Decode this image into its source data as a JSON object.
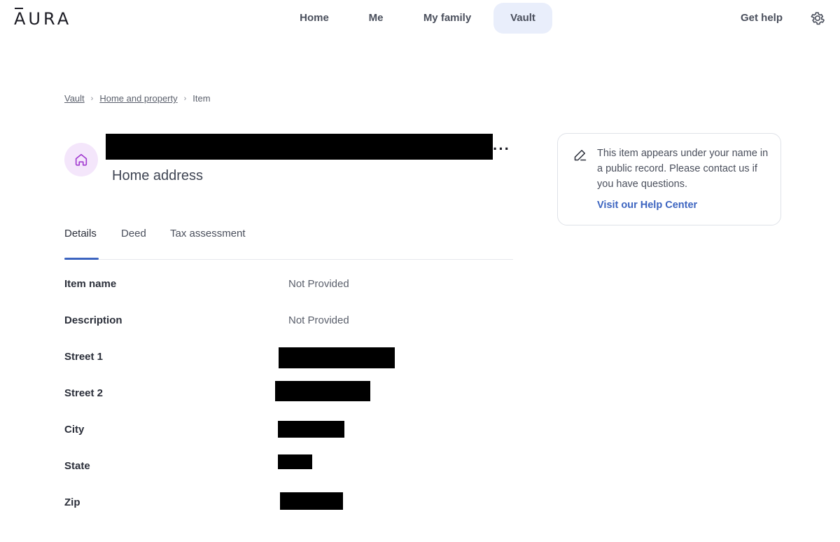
{
  "app": {
    "logo_text": "AURA"
  },
  "nav": {
    "items": [
      {
        "label": "Home"
      },
      {
        "label": "Me"
      },
      {
        "label": "My family"
      },
      {
        "label": "Vault"
      }
    ],
    "active": "Vault",
    "get_help": "Get help"
  },
  "breadcrumb": {
    "items": [
      "Vault",
      "Home and property",
      "Item"
    ],
    "separator": "›"
  },
  "item": {
    "title_redacted": true,
    "type_label": "Home address",
    "more_label": "···"
  },
  "tabs": {
    "items": [
      "Details",
      "Deed",
      "Tax assessment"
    ],
    "active": "Details"
  },
  "details": {
    "rows": [
      {
        "label": "Item name",
        "value": "Not Provided"
      },
      {
        "label": "Description",
        "value": "Not Provided"
      },
      {
        "label": "Street 1",
        "value": "",
        "redacted": true
      },
      {
        "label": "Street 2",
        "value": "",
        "redacted": true
      },
      {
        "label": "City",
        "value": "",
        "redacted": true
      },
      {
        "label": "State",
        "value": "",
        "redacted": true
      },
      {
        "label": "Zip",
        "value": "",
        "redacted": true
      }
    ]
  },
  "info_card": {
    "text": "This item appears under your name in a public record. Please contact us if you have questions.",
    "link": "Visit our Help Center"
  },
  "colors": {
    "accent": "#3c64c0",
    "nav_active_bg": "#e9eefb",
    "icon_bg": "#f4e6fb",
    "icon_stroke": "#a23bd0"
  }
}
